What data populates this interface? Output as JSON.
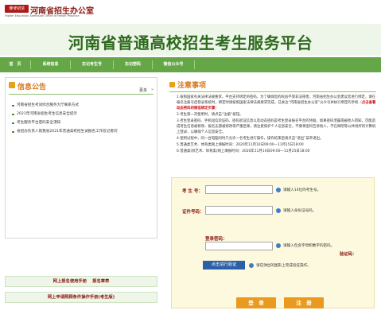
{
  "header": {
    "logo_text": "豫考招生",
    "org_name": "河南省招生办公室",
    "org_name_en": "Higher Education Admission Office of Henan Province"
  },
  "banner": {
    "title": "河南省普通高校招生考生服务平台"
  },
  "nav": {
    "items": [
      {
        "label": "首　页"
      },
      {
        "label": "系统信息"
      },
      {
        "label": "忘记考生号"
      },
      {
        "label": "忘记密码"
      },
      {
        "label": "微信公众号"
      }
    ]
  },
  "notices": {
    "title": "信息公告",
    "more_label": "更多",
    "items": [
      {
        "text": "河南省招生考试综合服务大厅联系方式"
      },
      {
        "text": "2021年河南省招生考生信息安全提示"
      },
      {
        "text": "考生服务平台密码安全须知"
      },
      {
        "text": "省招办负责人就我省2021年普通高校招生试报名工作答记者问"
      }
    ]
  },
  "manuals": {
    "items": [
      {
        "label": "网上报名使用手册　 报名章表"
      },
      {
        "label": "网上申请照顾条件操作手册(考生版)"
      }
    ]
  },
  "caution": {
    "title": "注意事项",
    "items": [
      {
        "text": "1.按照国家有关法律法规要求，平台支持绑定的密码，为了确保您的权益不受非法侵害，河南省招生办公室建议您进行绑定，请在报名注册号后登录系统时，绑定时请按照国家法律法规要求完成，已关注“河南省招生办公室”公众号并执行绑定的手机（",
        "red": "点击查看动态密码的微信绑定步骤",
        "tail": "）"
      },
      {
        "text": "2.考生第一次使用时，请点击“注册”按钮。"
      },
      {
        "text": "3.考生登录密码、手机短信验证码、密码验证信息以及动态密码是考生登录报名平台的凭据，如果密码泄露或被他人得知，可能造成考生信息被修改、报名志愿被修改等严重后果，请注意保护个人信息安全，不要将密码告诉他人，不在网吧等公共场所的计算机上登录，以确保个人信息安全。"
      },
      {
        "text": "4.使用过程中，同一台电脑同时只允许一名考生进行操作，操作结束后请点击“退出”菜单退出。"
      },
      {
        "text": "5.普通类艺术、体育类网上填报时间：2020年11月10日09:00—11月15日18:00"
      },
      {
        "text": "6.普通类(除艺术、体育类)网上填报时间：2020年11月10日09:00—11月25日18:00"
      }
    ]
  },
  "form": {
    "kaoshenghao_label": "考 生 号：",
    "kaoshenghao_placeholder": "",
    "kaoshenghao_hint": "请输入14位的考生号。",
    "zhengjianhao_label": "证件号码：",
    "zhengjianhao_placeholder": "",
    "zhengjianhao_hint": "请输入身份证号码。",
    "password_label": "登录密码：",
    "password_placeholder": "",
    "password_hint": "请输入包含字母和数字的密码。",
    "verify_button": "点击进行验证",
    "verify_hint": "请在弹出的图形上完成验证操作。",
    "verify_label": "验证码：",
    "login_button": "登　录",
    "register_button": "注　册"
  },
  "colors": {
    "nav_green": "#65a646",
    "banner_green": "#2e6a1d",
    "title_orange": "#d9781a",
    "button_orange": "#ea9a1e",
    "verify_blue": "#2c5fa8"
  }
}
